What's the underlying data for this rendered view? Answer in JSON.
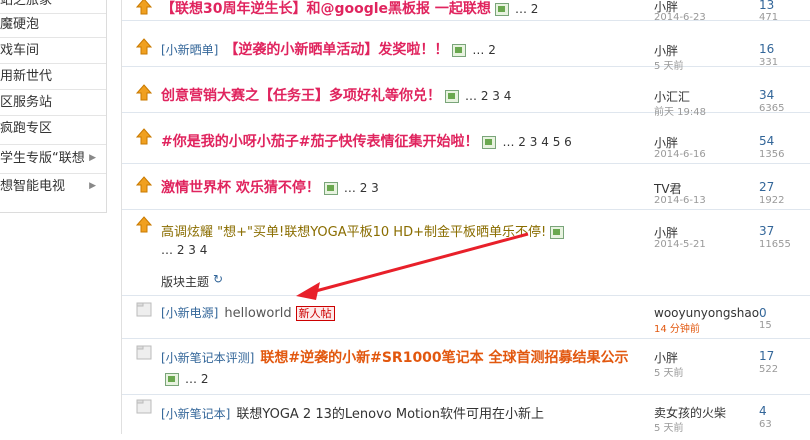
{
  "sidebar": {
    "items": [
      {
        "label": "站之旅家",
        "has_arrow": false
      },
      {
        "label": "魔硬泡",
        "has_arrow": false
      },
      {
        "label": "戏车间",
        "has_arrow": false
      },
      {
        "label": "用新世代",
        "has_arrow": false
      },
      {
        "label": "区服务站",
        "has_arrow": false
      },
      {
        "label": "疯跑专区",
        "has_arrow": false
      },
      {
        "label": "学生专版“联想",
        "has_arrow": true
      },
      {
        "label": "想智能电视",
        "has_arrow": true
      }
    ]
  },
  "section_header": {
    "label": "版块主题",
    "refresh_icon": "refresh-icon"
  },
  "threads": [
    {
      "tag": "",
      "title": "【联想30周年逆生长】和@google黑板报 一起联想",
      "title_style": "red",
      "has_image": true,
      "pages": [
        "2"
      ],
      "author": "小胖",
      "date": "2014-6-23",
      "replies": "13",
      "views": "471",
      "icon": "hot-up-icon"
    },
    {
      "tag": "[小新晒单]",
      "title": "【逆袭的小新晒单活动】发奖啦！！",
      "title_style": "red",
      "has_image": true,
      "pages": [
        "2"
      ],
      "author": "小胖",
      "date": "5 天前",
      "replies": "16",
      "views": "331",
      "icon": "hot-up-icon"
    },
    {
      "tag": "",
      "title": "创意营销大赛之【任务王】多项好礼等你兑！",
      "title_style": "red",
      "has_image": true,
      "pages": [
        "2",
        "3",
        "4"
      ],
      "author": "小汇汇",
      "date": "前天 19:48",
      "replies": "34",
      "views": "6365",
      "icon": "hot-up-icon"
    },
    {
      "tag": "",
      "title": "#你是我的小呀小茄子#茄子快传表情征集开始啦！",
      "title_style": "red",
      "has_image": true,
      "pages": [
        "2",
        "3",
        "4",
        "5",
        "6"
      ],
      "author": "小胖",
      "date": "2014-6-16",
      "replies": "54",
      "views": "1356",
      "icon": "hot-up-icon"
    },
    {
      "tag": "",
      "title": "激情世界杯 欢乐猜不停！",
      "title_style": "red",
      "has_image": true,
      "pages": [
        "2",
        "3"
      ],
      "author": "TV君",
      "date": "2014-6-13",
      "replies": "27",
      "views": "1922",
      "icon": "hot-up-icon"
    },
    {
      "tag": "",
      "title": "高调炫耀 \"想+\"买单!联想YOGA平板10 HD+制金平板晒单乐不停!",
      "title_style": "olive",
      "has_image": true,
      "pages": [
        "2",
        "3",
        "4"
      ],
      "author": "小胖",
      "date": "2014-5-21",
      "replies": "37",
      "views": "11655",
      "icon": "hot-up-icon"
    },
    {
      "tag": "[小新电源]",
      "title": "helloworld",
      "title_style": "gray",
      "has_image": false,
      "new_badge": "新人帖",
      "pages": [],
      "author": "wooyunyongshao",
      "date": "14 分钟前",
      "replies": "0",
      "views": "15",
      "icon": "folder-icon"
    },
    {
      "tag": "[小新笔记本评测]",
      "title": "联想#逆袭的小新#SR1000笔记本 全球首测招募结果公示",
      "title_style": "orange",
      "has_image": true,
      "pages": [
        "2"
      ],
      "author": "小胖",
      "date": "5 天前",
      "replies": "17",
      "views": "522",
      "icon": "folder-icon"
    },
    {
      "tag": "[小新笔记本]",
      "title": "联想YOGA 2 13的Lenovo Motion软件可用在小新上",
      "title_style": "plain",
      "has_image": false,
      "pages": [],
      "author": "卖女孩的火柴",
      "date": "5 天前",
      "replies": "4",
      "views": "63",
      "icon": "folder-icon"
    }
  ],
  "colors": {
    "tag": "#336699",
    "red_title": "#e0245e",
    "orange_title": "#e2580f",
    "arrow": "#e8202a"
  }
}
